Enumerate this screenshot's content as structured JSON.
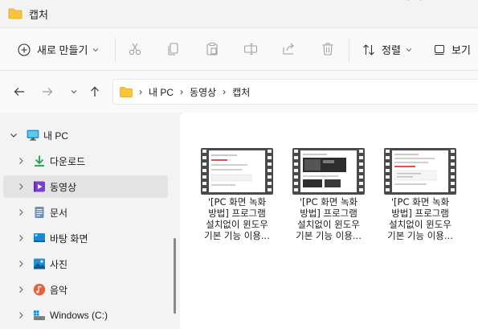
{
  "window": {
    "title": "캡처"
  },
  "toolbar": {
    "new_label": "새로 만들기",
    "sort_label": "정렬",
    "view_label": "보기",
    "tools": [
      "cut-icon",
      "copy-icon",
      "paste-icon",
      "rename-icon",
      "share-icon",
      "delete-icon"
    ]
  },
  "address": {
    "crumbs": [
      "내 PC",
      "동영상",
      "캡처"
    ]
  },
  "sidebar": {
    "items": [
      {
        "label": "내 PC",
        "icon": "pc-icon",
        "expanded": true,
        "selected": false
      },
      {
        "label": "다운로드",
        "icon": "download-icon",
        "expanded": false,
        "selected": false
      },
      {
        "label": "동영상",
        "icon": "video-icon",
        "expanded": false,
        "selected": true
      },
      {
        "label": "문서",
        "icon": "document-icon",
        "expanded": false,
        "selected": false
      },
      {
        "label": "바탕 화면",
        "icon": "desktop-icon",
        "expanded": false,
        "selected": false
      },
      {
        "label": "사진",
        "icon": "pictures-icon",
        "expanded": false,
        "selected": false
      },
      {
        "label": "음악",
        "icon": "music-icon",
        "expanded": false,
        "selected": false
      },
      {
        "label": "Windows (C:)",
        "icon": "drive-icon",
        "expanded": false,
        "selected": false
      }
    ]
  },
  "files": [
    {
      "line1": "'[PC 화면 녹화",
      "line2": "방법] 프로그램",
      "line3": "설치없이 윈도우",
      "line4": "기본 기능 이용..."
    },
    {
      "line1": "'[PC 화면 녹화",
      "line2": "방법] 프로그램",
      "line3": "설치없이 윈도우",
      "line4": "기본 기능 이용..."
    },
    {
      "line1": "'[PC 화면 녹화",
      "line2": "방법] 프로그램",
      "line3": "설치없이 윈도우",
      "line4": "기본 기능 이용..."
    }
  ],
  "colors": {
    "folder": "#f8c53a",
    "accent": "#005fb8",
    "selected_bg": "#e3e3e3"
  }
}
